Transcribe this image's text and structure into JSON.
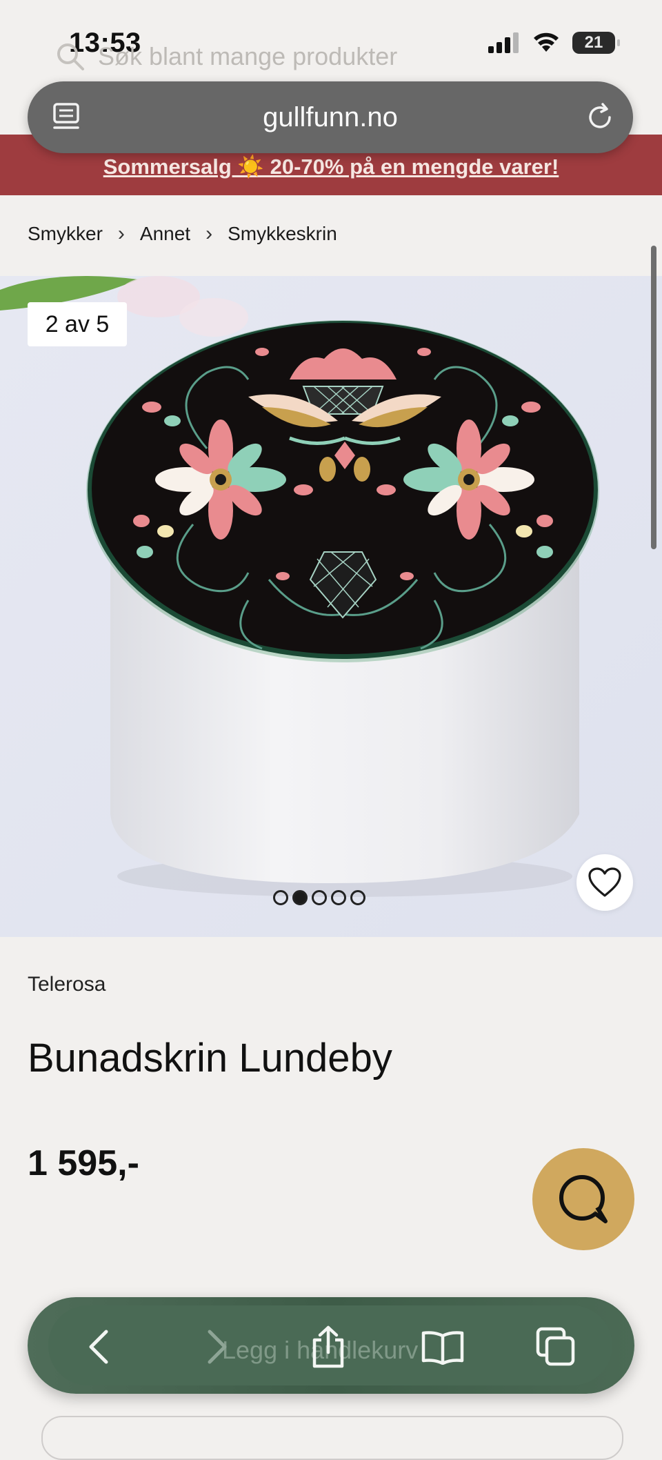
{
  "status_bar": {
    "time": "13:53",
    "battery": "21"
  },
  "browser": {
    "ghost_search_placeholder": "Søk blant mange produkter",
    "url": "gullfunn.no"
  },
  "promo": {
    "text": "Sommersalg ☀️ 20-70% på en mengde varer!"
  },
  "breadcrumb": [
    "Smykker",
    "Annet",
    "Smykkeskrin"
  ],
  "gallery": {
    "counter": "2 av 5",
    "total_images": 5,
    "active_index": 2
  },
  "product": {
    "brand": "Telerosa",
    "name": "Bunadskrin Lundeby",
    "price": "1 595,-"
  },
  "toolbar": {
    "ghost_cta": "Legg i handlekurv"
  },
  "icons": [
    "search-icon",
    "reader-icon",
    "reload-icon",
    "heart-icon",
    "chat-icon",
    "back-icon",
    "forward-icon",
    "share-icon",
    "bookmarks-icon",
    "tabs-icon"
  ],
  "colors": {
    "promo": "#9e3c3f",
    "chat": "#d0a85e",
    "toolbar": "#4a6a55",
    "address_bar": "#676767"
  }
}
